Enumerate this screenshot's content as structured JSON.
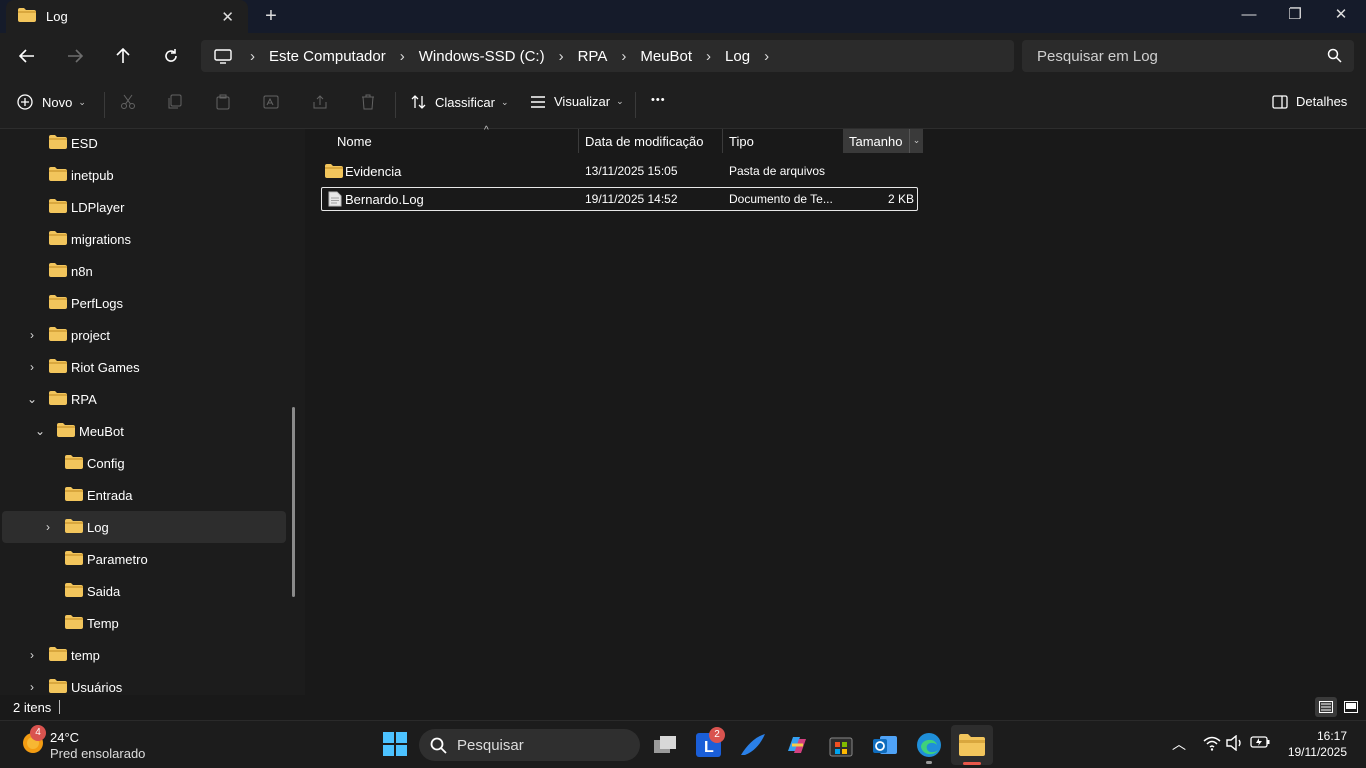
{
  "window": {
    "tab_title": "Log",
    "tab_close": "✕",
    "new_tab": "+",
    "minimize": "—",
    "maximize": "❐",
    "close": "✕"
  },
  "address": {
    "crumbs": [
      "Este Computador",
      "Windows-SSD (C:)",
      "RPA",
      "MeuBot",
      "Log"
    ],
    "search_placeholder": "Pesquisar em Log"
  },
  "commands": {
    "new_label": "Novo",
    "sort_label": "Classificar",
    "view_label": "Visualizar",
    "more_label": "•••",
    "details_label": "Detalhes"
  },
  "nav": {
    "items": [
      {
        "label": "ESD"
      },
      {
        "label": "inetpub"
      },
      {
        "label": "LDPlayer"
      },
      {
        "label": "migrations"
      },
      {
        "label": "n8n"
      },
      {
        "label": "PerfLogs"
      },
      {
        "label": "project"
      },
      {
        "label": "Riot Games"
      },
      {
        "label": "RPA"
      },
      {
        "label": "MeuBot"
      },
      {
        "label": "Config"
      },
      {
        "label": "Entrada"
      },
      {
        "label": "Log"
      },
      {
        "label": "Parametro"
      },
      {
        "label": "Saida"
      },
      {
        "label": "Temp"
      },
      {
        "label": "temp"
      },
      {
        "label": "Usuários"
      }
    ]
  },
  "columns": {
    "name": "Nome",
    "modified": "Data de modificação",
    "type": "Tipo",
    "size": "Tamanho"
  },
  "files": [
    {
      "name": "Evidencia",
      "modified": "13/11/2025 15:05",
      "type": "Pasta de arquivos",
      "size": ""
    },
    {
      "name": "Bernardo.Log",
      "modified": "19/11/2025 14:52",
      "type": "Documento de Te...",
      "size": "2 KB"
    }
  ],
  "status": {
    "item_count": "2 itens"
  },
  "taskbar": {
    "weather_temp": "24°C",
    "weather_desc": "Pred ensolarado",
    "weather_badge": "4",
    "search_label": "Pesquisar",
    "l_badge": "2",
    "clock_time": "16:17",
    "clock_date": "19/11/2025"
  },
  "colors": {
    "folder": "#f2c55c",
    "folder_dark": "#d9a73e",
    "accent": "#4cc2ff"
  }
}
